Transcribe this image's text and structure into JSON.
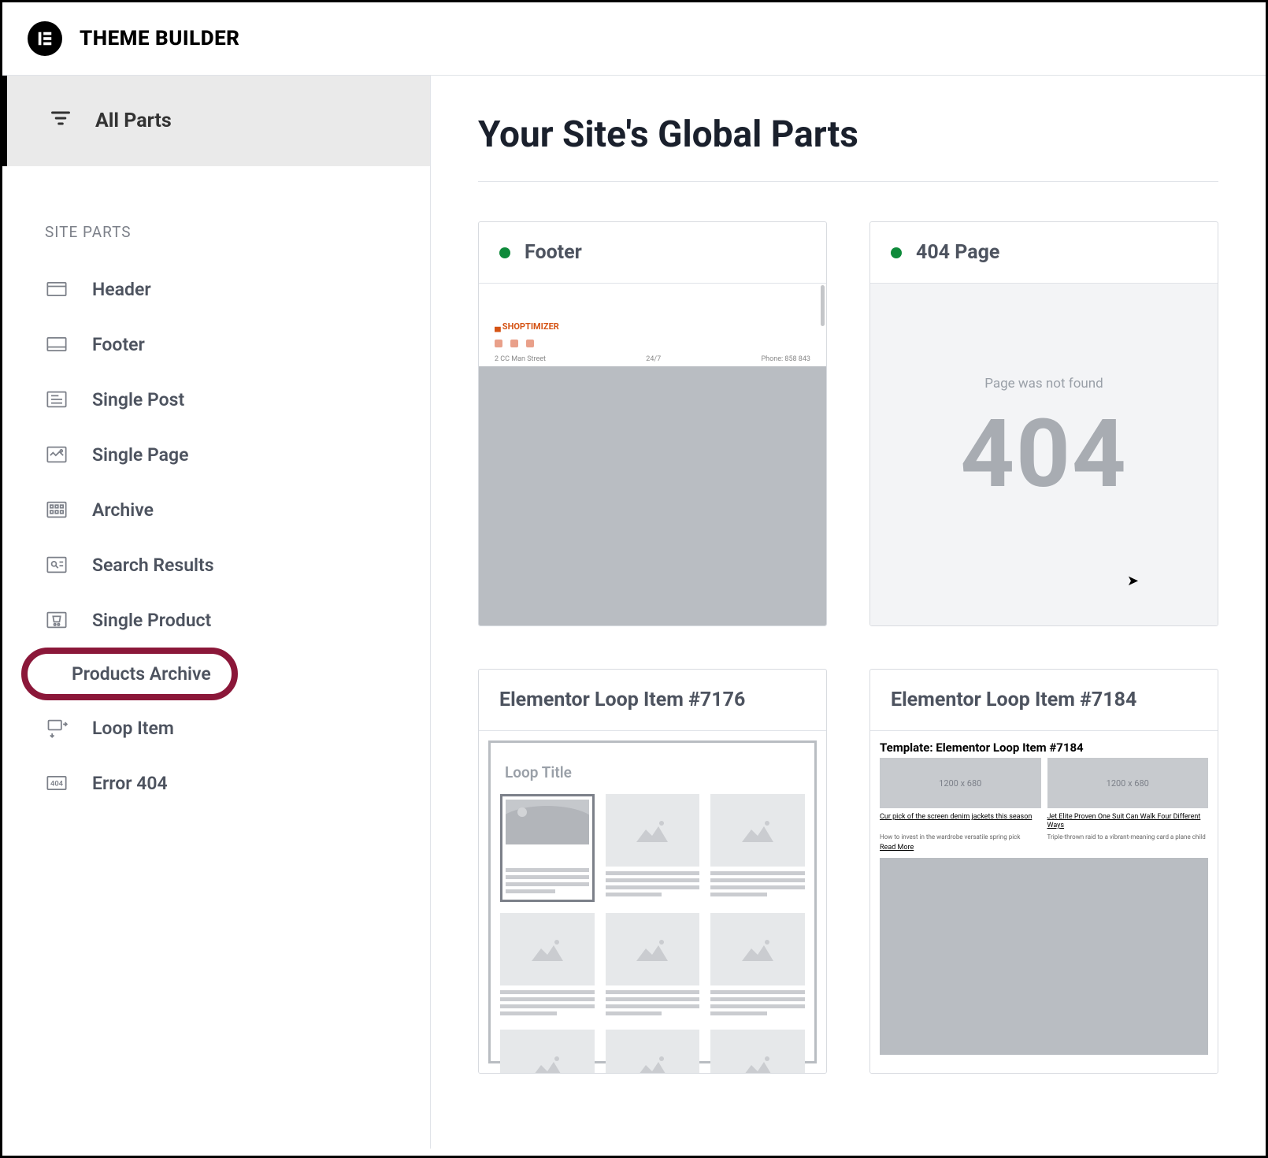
{
  "header": {
    "app_title": "THEME BUILDER"
  },
  "sidebar": {
    "all_parts_label": "All Parts",
    "section_label": "SITE PARTS",
    "items": [
      {
        "label": "Header"
      },
      {
        "label": "Footer"
      },
      {
        "label": "Single Post"
      },
      {
        "label": "Single Page"
      },
      {
        "label": "Archive"
      },
      {
        "label": "Search Results"
      },
      {
        "label": "Single Product"
      },
      {
        "label": "Products Archive"
      },
      {
        "label": "Loop Item"
      },
      {
        "label": "Error 404"
      }
    ]
  },
  "main": {
    "page_title": "Your Site's Global Parts",
    "cards": [
      {
        "title": "Footer",
        "status": "active",
        "preview": {
          "logo_text": "SHOPTIMIZER",
          "meta1": "2 CC Man Street",
          "meta2": "24/7",
          "meta3": "Phone: 858 843"
        }
      },
      {
        "title": "404 Page",
        "status": "active",
        "preview": {
          "label": "Page was not found",
          "big": "404"
        }
      },
      {
        "title": "Elementor Loop Item #7176",
        "preview": {
          "loop_title": "Loop Title"
        }
      },
      {
        "title": "Elementor Loop Item #7184",
        "preview": {
          "template_label": "Template: Elementor Loop Item #7184",
          "ph_size": "1200 x 680",
          "link1": "Cur pick of the screen denim jackets this season",
          "link2": "Jet Elite Proven One Suit Can Walk Four Different Ways",
          "meta1": "How to invest in the wardrobe versatile spring pick",
          "meta2": "Triple-thrown raid to a vibrant-meaning card a plane child",
          "more": "Read More"
        }
      }
    ]
  },
  "colors": {
    "accent_ellipse": "#8b1739",
    "status_green": "#0e8a3a"
  }
}
